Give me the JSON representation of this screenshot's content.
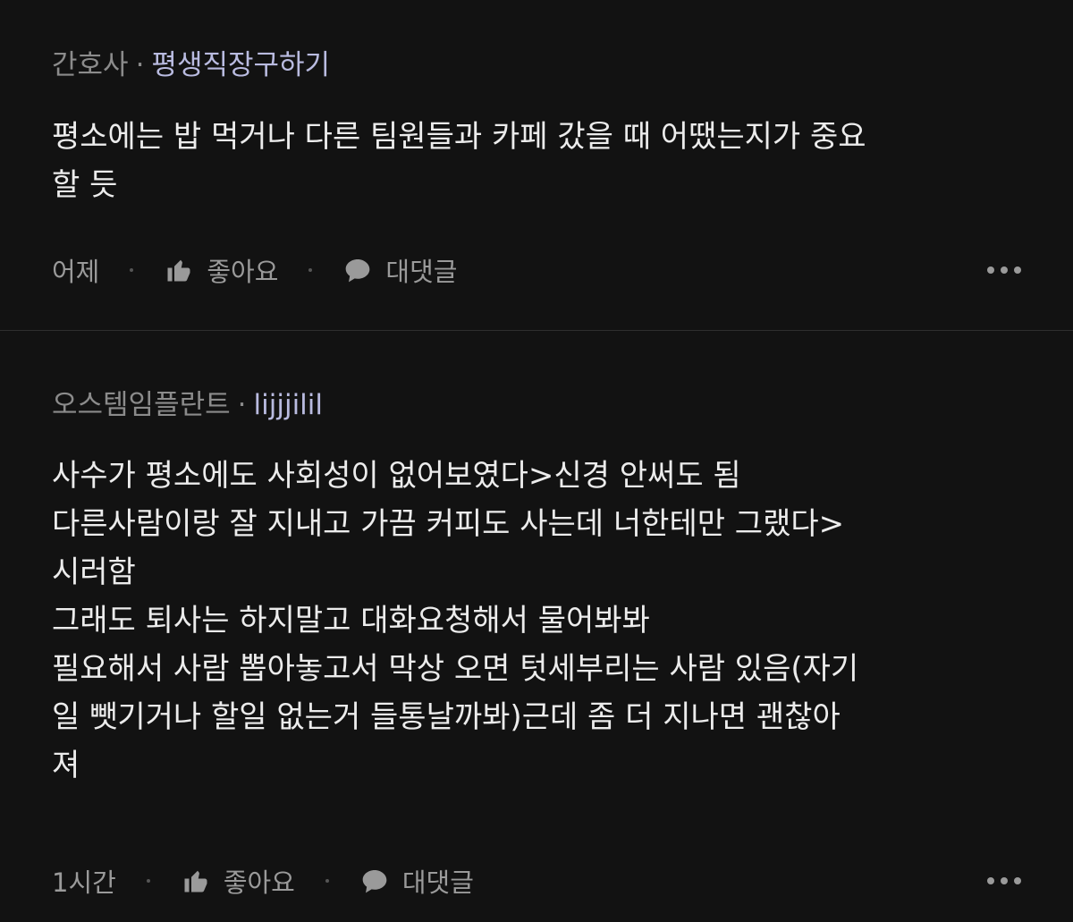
{
  "comments": [
    {
      "job": "간호사",
      "nickname": "평생직장구하기",
      "lines": [
        "평소에는 밥 먹거나 다른 팀원들과 카페 갔을 때 어땠는지가 중요",
        "할 듯"
      ],
      "time": "어제",
      "like_label": "좋아요",
      "reply_label": "대댓글"
    },
    {
      "job": "오스템임플란트",
      "nickname": "lijjjilil",
      "lines": [
        "사수가 평소에도 사회성이 없어보였다>신경 안써도 됨",
        "다른사람이랑 잘 지내고 가끔 커피도 사는데 너한테만 그랬다>",
        "시러함",
        "그래도 퇴사는 하지말고 대화요청해서 물어봐봐",
        "필요해서 사람 뽑아놓고서 막상 오면 텃세부리는 사람 있음(자기",
        "일 뺏기거나 할일 없는거 들통날까봐)근데 좀 더 지나면 괜찮아",
        "져"
      ],
      "time": "1시간",
      "like_label": "좋아요",
      "reply_label": "대댓글"
    }
  ],
  "separator": "·",
  "colors": {
    "background": "#121212",
    "text": "#ececec",
    "muted": "#8b8b8b",
    "nickname": "#b9bbe0"
  }
}
